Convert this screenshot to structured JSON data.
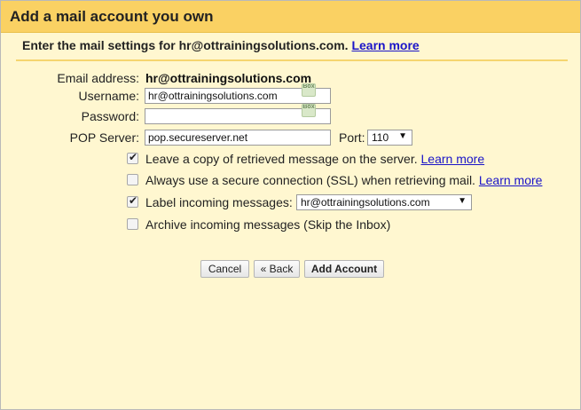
{
  "dialog": {
    "title": "Add a mail account you own",
    "subtitle": "Enter the mail settings for hr@ottrainingsolutions.com.",
    "subtitle_link": "Learn more"
  },
  "form": {
    "email_label": "Email address:",
    "email_value": "hr@ottrainingsolutions.com",
    "username_label": "Username:",
    "username_value": "hr@ottrainingsolutions.com",
    "password_label": "Password:",
    "password_value": "",
    "pop_label": "POP Server:",
    "pop_value": "pop.secureserver.net",
    "port_label": "Port:",
    "port_value": "110",
    "autofill_badge": "Box"
  },
  "options": [
    {
      "label": "Leave a copy of retrieved message on the server.",
      "checked": true,
      "link": "Learn more"
    },
    {
      "label": "Always use a secure connection (SSL) when retrieving mail.",
      "checked": false,
      "link": "Learn more"
    },
    {
      "label": "Label incoming messages:",
      "checked": true,
      "select_value": "hr@ottrainingsolutions.com"
    },
    {
      "label": "Archive incoming messages (Skip the Inbox)",
      "checked": false
    }
  ],
  "buttons": {
    "cancel": "Cancel",
    "back": "« Back",
    "add": "Add Account"
  },
  "colors": {
    "title_bar": "#fad163",
    "background": "#fff7d0",
    "link": "#1a14c8"
  }
}
